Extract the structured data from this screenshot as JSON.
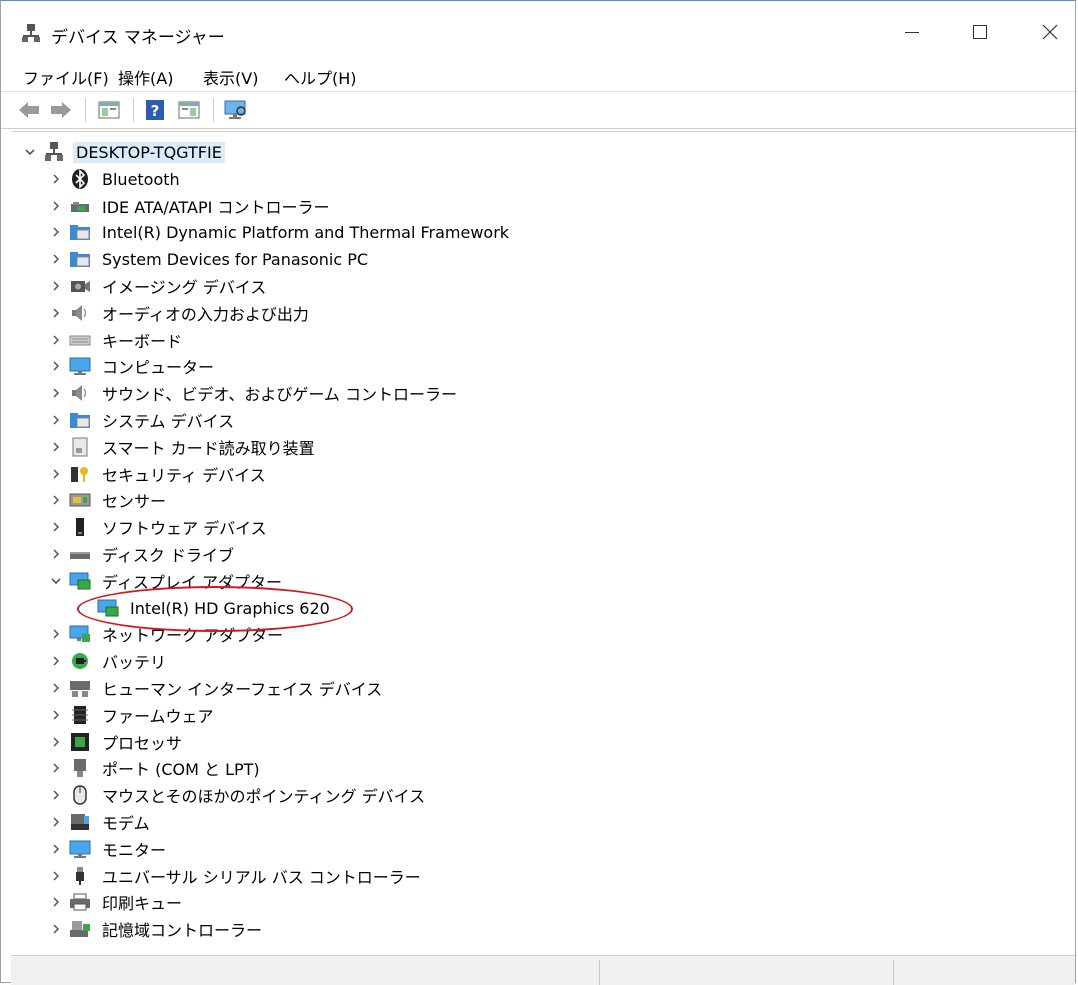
{
  "window": {
    "title": "デバイス マネージャー",
    "controls": {
      "minimize": "minimize-icon",
      "maximize": "maximize-icon",
      "close": "close-icon"
    }
  },
  "menu": [
    {
      "label": "ファイル(F)"
    },
    {
      "label": "操作(A)"
    },
    {
      "label": "表示(V)"
    },
    {
      "label": "ヘルプ(H)"
    }
  ],
  "toolbar": {
    "buttons": [
      "back-arrow-icon",
      "forward-arrow-icon",
      "properties-panel-icon",
      "help-icon",
      "action-panel-icon",
      "monitor-scan-icon"
    ]
  },
  "tree": {
    "root": {
      "label": "DESKTOP-TQGTFIE",
      "icon": "computer-network-icon",
      "expanded": true,
      "selected": true
    },
    "categories": [
      {
        "label": "Bluetooth",
        "icon": "bluetooth-icon"
      },
      {
        "label": "IDE ATA/ATAPI コントローラー",
        "icon": "ide-controller-icon"
      },
      {
        "label": "Intel(R) Dynamic Platform and Thermal Framework",
        "icon": "system-folder-icon"
      },
      {
        "label": "System Devices for Panasonic PC",
        "icon": "system-folder-icon"
      },
      {
        "label": "イメージング デバイス",
        "icon": "camera-icon"
      },
      {
        "label": "オーディオの入力および出力",
        "icon": "speaker-icon"
      },
      {
        "label": "キーボード",
        "icon": "keyboard-icon"
      },
      {
        "label": "コンピューター",
        "icon": "monitor-icon"
      },
      {
        "label": "サウンド、ビデオ、およびゲーム コントローラー",
        "icon": "speaker-icon"
      },
      {
        "label": "システム デバイス",
        "icon": "system-folder-icon"
      },
      {
        "label": "スマート カード読み取り装置",
        "icon": "smart-card-icon"
      },
      {
        "label": "セキュリティ デバイス",
        "icon": "security-key-icon"
      },
      {
        "label": "センサー",
        "icon": "sensor-icon"
      },
      {
        "label": "ソフトウェア デバイス",
        "icon": "software-device-icon"
      },
      {
        "label": "ディスク ドライブ",
        "icon": "disk-drive-icon"
      },
      {
        "label": "ディスプレイ アダプター",
        "icon": "display-adapter-icon",
        "expanded": true,
        "children": [
          {
            "label": "Intel(R) HD Graphics 620",
            "icon": "display-adapter-icon",
            "annotated": true
          }
        ]
      },
      {
        "label": "ネットワーク アダプター",
        "icon": "network-adapter-icon"
      },
      {
        "label": "バッテリ",
        "icon": "battery-icon"
      },
      {
        "label": "ヒューマン インターフェイス デバイス",
        "icon": "hid-icon"
      },
      {
        "label": "ファームウェア",
        "icon": "firmware-icon"
      },
      {
        "label": "プロセッサ",
        "icon": "processor-icon"
      },
      {
        "label": "ポート (COM と LPT)",
        "icon": "port-icon"
      },
      {
        "label": "マウスとそのほかのポインティング デバイス",
        "icon": "mouse-icon"
      },
      {
        "label": "モデム",
        "icon": "modem-icon"
      },
      {
        "label": "モニター",
        "icon": "monitor-icon"
      },
      {
        "label": "ユニバーサル シリアル バス コントローラー",
        "icon": "usb-icon"
      },
      {
        "label": "印刷キュー",
        "icon": "printer-icon"
      },
      {
        "label": "記憶域コントローラー",
        "icon": "storage-controller-icon"
      }
    ]
  },
  "annotation_color": "#d0191f",
  "selection_color": "#dcebfc"
}
